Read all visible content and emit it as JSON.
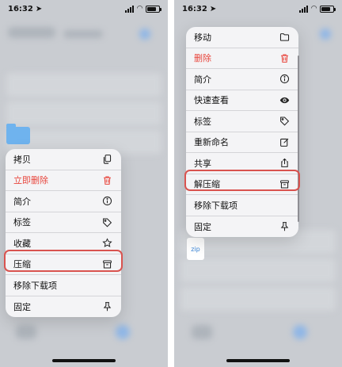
{
  "status_bar": {
    "time": "16:32"
  },
  "left_menu": {
    "items": [
      {
        "label": "拷贝",
        "icon": "copy-icon",
        "danger": false
      },
      {
        "label": "立即删除",
        "icon": "trash-icon",
        "danger": true
      },
      {
        "label": "简介",
        "icon": "info-icon",
        "danger": false
      },
      {
        "label": "标签",
        "icon": "tag-icon",
        "danger": false
      },
      {
        "label": "收藏",
        "icon": "star-icon",
        "danger": false
      },
      {
        "label": "压缩",
        "icon": "archive-icon",
        "danger": false,
        "highlighted": true
      },
      {
        "label": "移除下载项",
        "icon": "",
        "danger": false
      },
      {
        "label": "固定",
        "icon": "pin-icon",
        "danger": false
      }
    ]
  },
  "right_menu": {
    "items": [
      {
        "label": "移动",
        "icon": "folder-icon",
        "danger": false
      },
      {
        "label": "删除",
        "icon": "trash-icon",
        "danger": true
      },
      {
        "label": "简介",
        "icon": "info-icon",
        "danger": false
      },
      {
        "label": "快速查看",
        "icon": "eye-icon",
        "danger": false
      },
      {
        "label": "标签",
        "icon": "tag-icon",
        "danger": false
      },
      {
        "label": "重新命名",
        "icon": "rename-icon",
        "danger": false
      },
      {
        "label": "共享",
        "icon": "share-icon",
        "danger": false
      },
      {
        "label": "解压缩",
        "icon": "archive-icon",
        "danger": false,
        "highlighted": true
      },
      {
        "label": "移除下载项",
        "icon": "",
        "danger": false
      },
      {
        "label": "固定",
        "icon": "pin-icon",
        "danger": false
      }
    ]
  },
  "zip_file": {
    "label": "zip"
  },
  "colors": {
    "danger": "#e8453c",
    "highlight": "#d9534f",
    "folder": "#6fb3ee"
  }
}
